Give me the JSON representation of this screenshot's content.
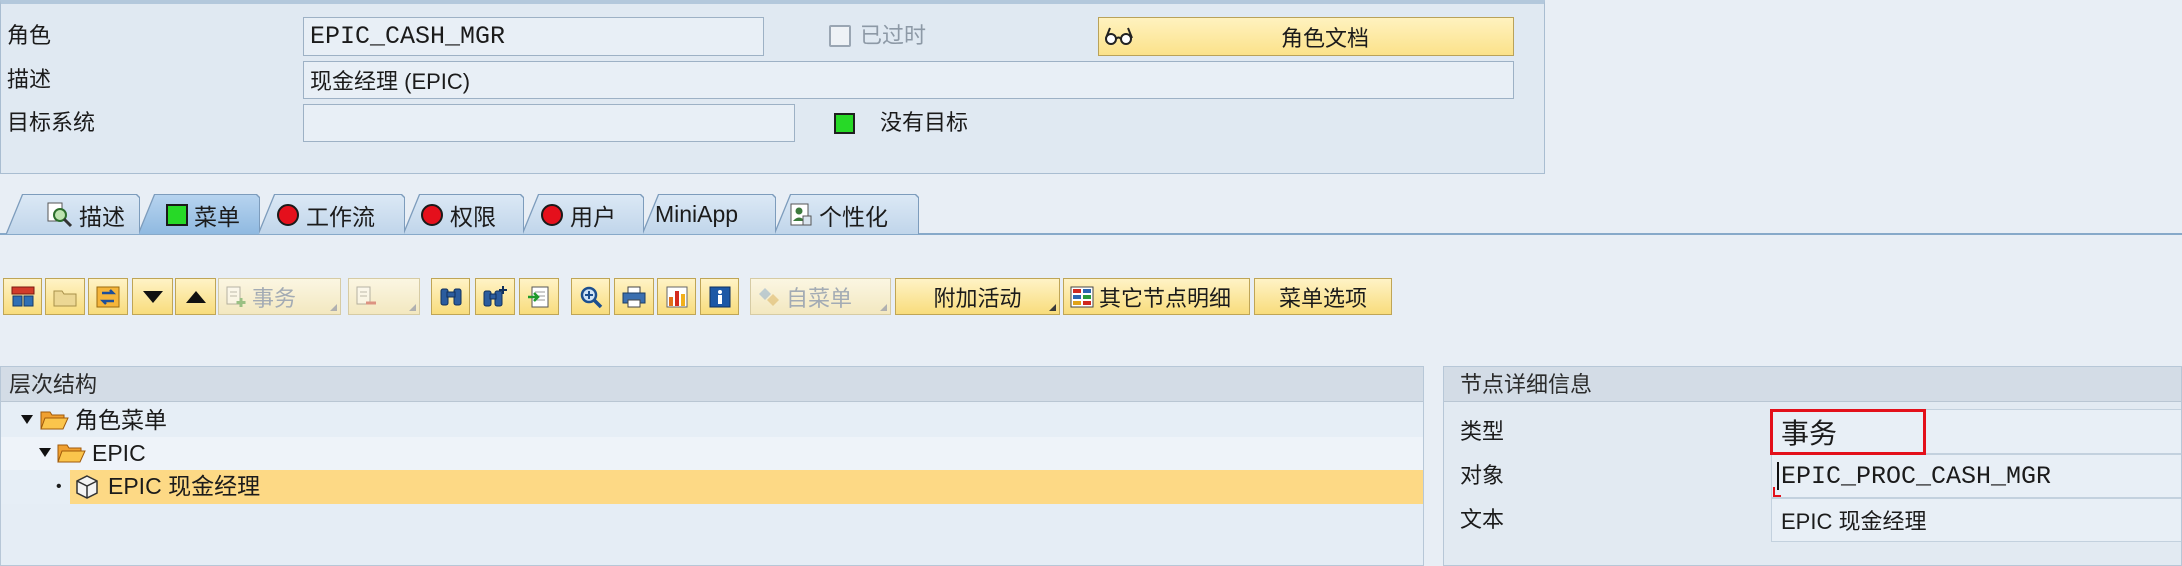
{
  "header": {
    "role_label": "角色",
    "role_value": "EPIC_CASH_MGR",
    "obsolete_label": "已过时",
    "obsolete_checked": false,
    "role_doc_button": "角色文档",
    "role_doc_icon": "glasses-icon",
    "description_label": "描述",
    "description_value": "现金经理 (EPIC)",
    "target_system_label": "目标系统",
    "target_system_value": "",
    "target_status_label": "没有目标",
    "target_status_icon": "green-status-icon"
  },
  "tabs": [
    {
      "label": "描述",
      "icon": "magnifier-document-icon",
      "active": false
    },
    {
      "label": "菜单",
      "icon": "green-status-icon",
      "active": true
    },
    {
      "label": "工作流",
      "icon": "red-status-icon",
      "active": false
    },
    {
      "label": "权限",
      "icon": "red-status-icon",
      "active": false
    },
    {
      "label": "用户",
      "icon": "red-status-icon",
      "active": false
    },
    {
      "label": "MiniApp",
      "active": false
    },
    {
      "label": "个性化",
      "icon": "personalization-icon",
      "active": false
    }
  ],
  "toolbar": {
    "buttons": [
      {
        "icon": "menu-tree-icon",
        "enabled": true
      },
      {
        "icon": "folder-icon",
        "enabled": true
      },
      {
        "icon": "swap-node-icon",
        "enabled": true
      },
      {
        "icon": "move-down-icon",
        "enabled": true
      },
      {
        "icon": "move-up-icon",
        "enabled": true
      },
      {
        "icon": "add-transaction-icon",
        "label": "事务",
        "enabled": false,
        "dropdown": true
      },
      {
        "icon": "remove-node-icon",
        "enabled": false,
        "dropdown": true
      },
      {
        "icon": "binoculars-icon",
        "enabled": true
      },
      {
        "icon": "binoculars-plus-icon",
        "enabled": true
      },
      {
        "icon": "import-document-icon",
        "enabled": true
      },
      {
        "icon": "zoom-in-icon",
        "enabled": true
      },
      {
        "icon": "printer-icon",
        "enabled": true
      },
      {
        "icon": "chart-icon",
        "enabled": true
      },
      {
        "icon": "info-icon",
        "enabled": true
      },
      {
        "icon": "submenu-icon",
        "label": "自菜单",
        "enabled": false,
        "dropdown": true
      },
      {
        "label": "附加活动",
        "enabled": true,
        "dropdown": true
      },
      {
        "icon": "node-details-grid-icon",
        "label": "其它节点明细",
        "enabled": true
      },
      {
        "label": "菜单选项",
        "enabled": true
      }
    ]
  },
  "hierarchy": {
    "title": "层次结构",
    "nodes": [
      {
        "label": "角色菜单",
        "icon": "folder-open-icon",
        "expanded": true
      },
      {
        "label": "EPIC",
        "icon": "folder-open-icon",
        "expanded": true
      },
      {
        "label": "EPIC 现金经理",
        "icon": "transaction-cube-icon",
        "selected": true
      }
    ]
  },
  "node_details": {
    "title": "节点详细信息",
    "rows": [
      {
        "label": "类型",
        "value": "事务",
        "highlighted": true
      },
      {
        "label": "对象",
        "value": "EPIC_PROC_CASH_MGR",
        "has_cursor": true
      },
      {
        "label": "文本",
        "value": "EPIC 现金经理"
      }
    ]
  },
  "colors": {
    "page_bg": "#e8eef5",
    "accent_yellow": "#fbe28a",
    "selected_row": "#fdd985",
    "status_green": "#27d927",
    "status_red": "#e5101c",
    "annotation_red": "#e3101a"
  }
}
